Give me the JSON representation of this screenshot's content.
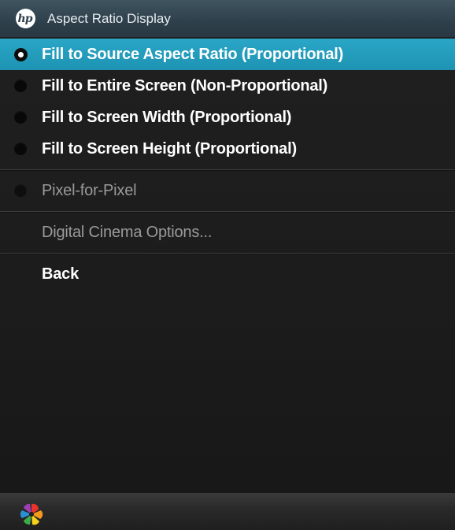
{
  "window": {
    "title": "Aspect Ratio Display",
    "logo_icon": "hp-logo-icon",
    "logo_text": "hp"
  },
  "menu": {
    "aspect_options": [
      {
        "label": "Fill to Source Aspect Ratio (Proportional)",
        "selected": true
      },
      {
        "label": "Fill to Entire Screen (Non-Proportional)",
        "selected": false
      },
      {
        "label": "Fill to Screen Width (Proportional)",
        "selected": false
      },
      {
        "label": "Fill to Screen Height (Proportional)",
        "selected": false
      }
    ],
    "pixel_for_pixel": {
      "label": "Pixel-for-Pixel",
      "enabled": false
    },
    "digital_cinema": {
      "label": "Digital Cinema Options...",
      "enabled": false
    },
    "back": {
      "label": "Back"
    }
  },
  "footer": {
    "icon": "pinwheel-icon"
  },
  "colors": {
    "highlight": "#1e93b3",
    "titlebar": "#2f414c",
    "background": "#1c1c1c",
    "disabled_text": "#9a9a9a"
  }
}
